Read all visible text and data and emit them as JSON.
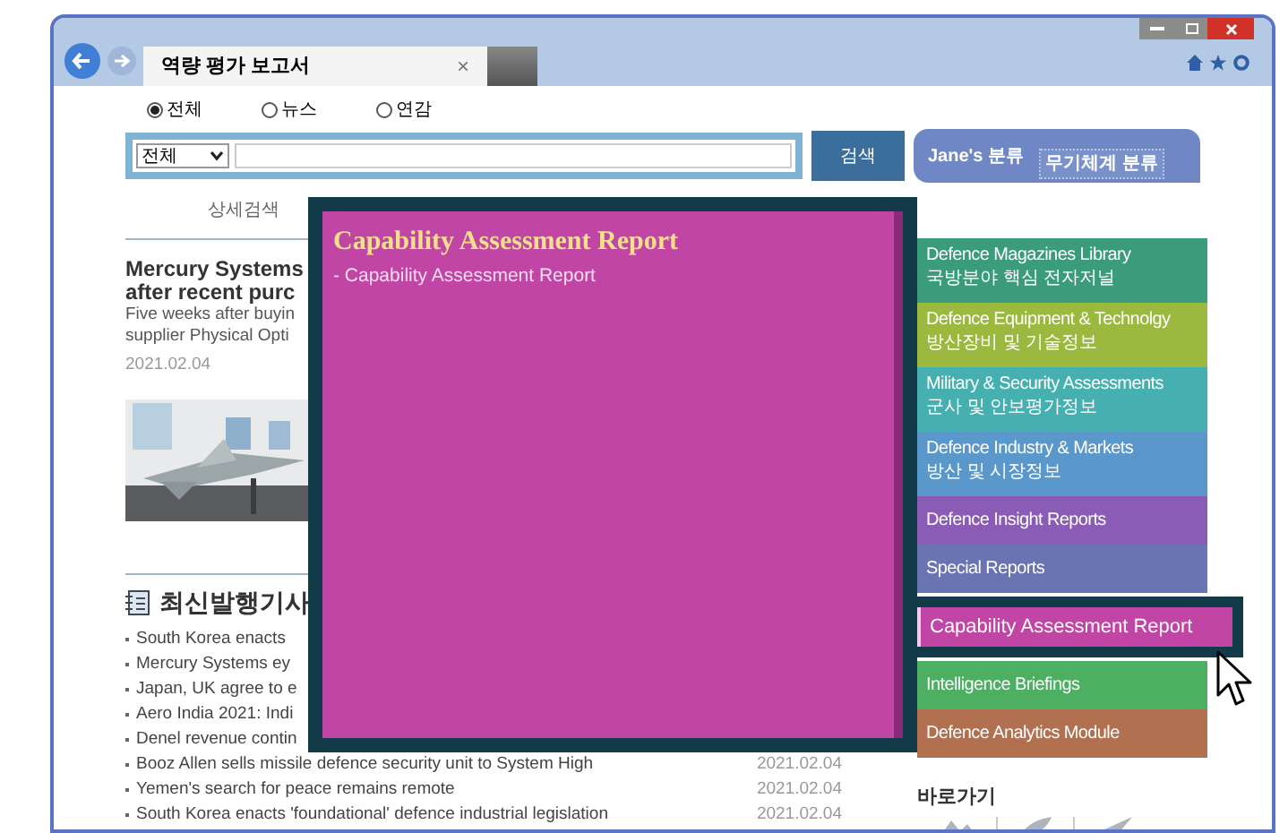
{
  "browser": {
    "tab_title": "역량 평가 보고서",
    "tab_close": "×"
  },
  "search": {
    "scopes": [
      {
        "label": "전체",
        "selected": true
      },
      {
        "label": "뉴스",
        "selected": false
      },
      {
        "label": "연감",
        "selected": false
      }
    ],
    "category": "전체",
    "button": "검색",
    "classification_tabs": [
      {
        "label": "Jane's 분류",
        "selected": false
      },
      {
        "label": "무기체계 분류",
        "selected": true
      }
    ],
    "advanced": "상세검색"
  },
  "featured": {
    "headline": [
      "Mercury Systems",
      "after recent purc"
    ],
    "summary": [
      "Five weeks after buyin",
      "supplier Physical Opti"
    ],
    "date": "2021.02.04"
  },
  "latest": {
    "title": "최신발행기사",
    "items": [
      {
        "title": "South Korea enacts"
      },
      {
        "title": "Mercury Systems ey"
      },
      {
        "title": "Japan, UK agree to e"
      },
      {
        "title": "Aero India 2021: Indi"
      },
      {
        "title": "Denel revenue contin"
      },
      {
        "title": "Booz Allen sells missile defence security unit to System High",
        "date": "2021.02.04"
      },
      {
        "title": "Yemen's search for peace remains remote",
        "date": "2021.02.04"
      },
      {
        "title": "South Korea enacts 'foundational' defence industrial legislation",
        "date": "2021.02.04"
      }
    ]
  },
  "menu": [
    {
      "title": "Defence Magazines Library",
      "subtitle": "국방분야 핵심 전자저널",
      "color": "#3b9c7b",
      "selected": false
    },
    {
      "title": "Defence Equipment & Technolgy",
      "subtitle": "방산장비 및 기술정보",
      "color": "#9bb83f",
      "selected": false
    },
    {
      "title": "Military & Security Assessments",
      "subtitle": "군사 및 안보평가정보",
      "color": "#46b0b1",
      "selected": false
    },
    {
      "title": "Defence Industry & Markets",
      "subtitle": "방산 및 시장정보",
      "color": "#5a97cb",
      "selected": false
    },
    {
      "title": "Defence Insight Reports",
      "color": "#8b5cb6",
      "selected": false
    },
    {
      "title": "Special Reports",
      "color": "#6a74b3",
      "selected": false
    },
    {
      "title": "Capability Assessment Report",
      "color": "#c045a5",
      "selected": true
    },
    {
      "title": "Intelligence Briefings",
      "color": "#4caf62",
      "selected": false
    },
    {
      "title": "Defence Analytics Module",
      "color": "#b1704f",
      "selected": false
    }
  ],
  "submenu": {
    "title": "Capability Assessment Report",
    "items": [
      "- Capability Assessment Report"
    ]
  },
  "shortcuts": {
    "title": "바로가기"
  }
}
